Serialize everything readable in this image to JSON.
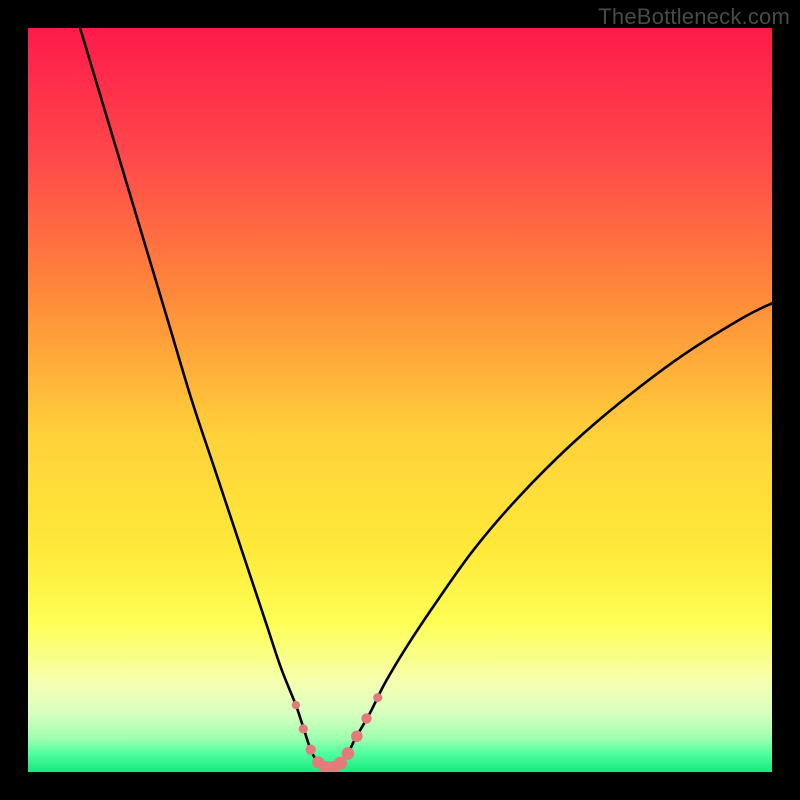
{
  "watermark": "TheBottleneck.com",
  "chart_data": {
    "type": "line",
    "title": "",
    "xlabel": "",
    "ylabel": "",
    "xlim": [
      0,
      100
    ],
    "ylim": [
      0,
      100
    ],
    "grid": false,
    "legend": false,
    "background_gradient_stops": [
      {
        "offset": 0.0,
        "color": "#ff1a4b"
      },
      {
        "offset": 0.18,
        "color": "#ff4a4a"
      },
      {
        "offset": 0.36,
        "color": "#ff8a3a"
      },
      {
        "offset": 0.55,
        "color": "#ffd23a"
      },
      {
        "offset": 0.7,
        "color": "#ffe93a"
      },
      {
        "offset": 0.8,
        "color": "#feff55"
      },
      {
        "offset": 0.88,
        "color": "#f6ffb0"
      },
      {
        "offset": 0.92,
        "color": "#d9ffc0"
      },
      {
        "offset": 0.955,
        "color": "#9effb0"
      },
      {
        "offset": 0.975,
        "color": "#4fffa0"
      },
      {
        "offset": 1.0,
        "color": "#18e880"
      }
    ],
    "series": [
      {
        "name": "bottleneck-curve",
        "color": "#000000",
        "x": [
          7,
          10,
          13,
          16,
          19,
          22,
          25,
          28,
          30,
          32,
          34,
          36,
          37,
          38,
          39,
          40,
          41,
          42,
          43,
          44,
          46,
          48,
          51,
          55,
          60,
          66,
          73,
          80,
          88,
          96,
          100
        ],
        "y": [
          100,
          90,
          80,
          70,
          60,
          50,
          41,
          32,
          26,
          20,
          14,
          9,
          6,
          3,
          1.2,
          0.6,
          0.6,
          1.2,
          2.5,
          4.5,
          8,
          12,
          17,
          23,
          30,
          37,
          44,
          50,
          56,
          61,
          63
        ]
      }
    ],
    "markers": {
      "name": "bottom-dots",
      "color": "#e47a7a",
      "radius_small": 4.2,
      "radius_large": 6.5,
      "points": [
        {
          "x": 36.0,
          "y": 9.0,
          "r": 4.2
        },
        {
          "x": 37.0,
          "y": 5.8,
          "r": 4.6
        },
        {
          "x": 38.0,
          "y": 3.0,
          "r": 5.2
        },
        {
          "x": 39.0,
          "y": 1.3,
          "r": 6.0
        },
        {
          "x": 40.0,
          "y": 0.6,
          "r": 6.5
        },
        {
          "x": 41.0,
          "y": 0.6,
          "r": 6.5
        },
        {
          "x": 42.0,
          "y": 1.2,
          "r": 6.5
        },
        {
          "x": 43.0,
          "y": 2.5,
          "r": 6.3
        },
        {
          "x": 44.2,
          "y": 4.8,
          "r": 5.8
        },
        {
          "x": 45.5,
          "y": 7.2,
          "r": 5.2
        },
        {
          "x": 47.0,
          "y": 10.0,
          "r": 4.5
        }
      ]
    }
  }
}
